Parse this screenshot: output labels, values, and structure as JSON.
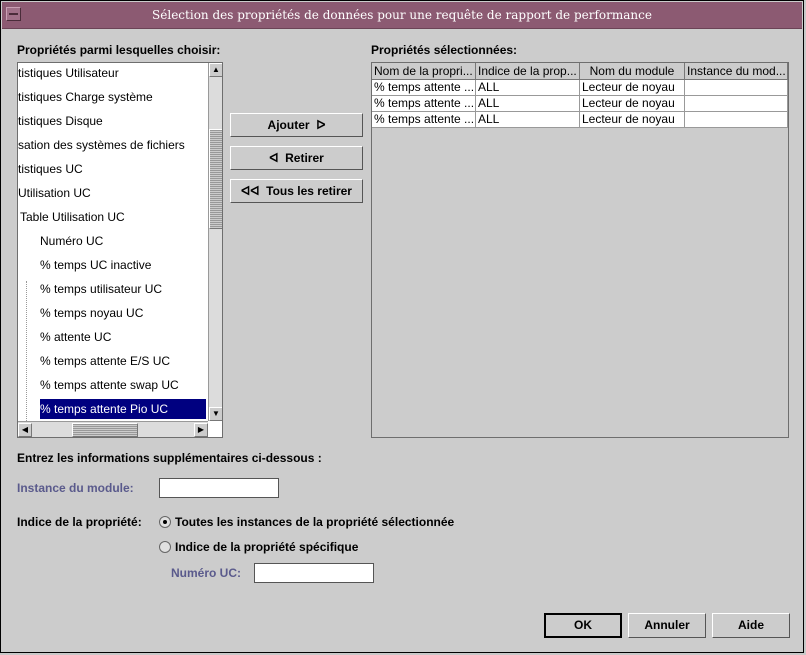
{
  "window": {
    "title": "Sélection des propriétés de données pour une requête de rapport de performance"
  },
  "available": {
    "label": "Propriétés parmi lesquelles choisir:",
    "items": [
      {
        "text": "tistiques Utilisateur",
        "selected": false
      },
      {
        "text": "tistiques Charge système",
        "selected": false
      },
      {
        "text": "tistiques Disque",
        "selected": false
      },
      {
        "text": "sation des systèmes de fichiers",
        "selected": false
      },
      {
        "text": "tistiques UC",
        "selected": false
      },
      {
        "text": "Utilisation UC",
        "selected": false
      },
      {
        "text": "Table Utilisation UC",
        "selected": false
      },
      {
        "text": "Numéro UC",
        "selected": false
      },
      {
        "text": "% temps UC inactive",
        "selected": false
      },
      {
        "text": "% temps utilisateur UC",
        "selected": false
      },
      {
        "text": "% temps noyau UC",
        "selected": false
      },
      {
        "text": "% attente UC",
        "selected": false
      },
      {
        "text": "% temps attente E/S UC",
        "selected": false
      },
      {
        "text": "% temps attente swap UC",
        "selected": false
      },
      {
        "text": "% temps attente Pio UC",
        "selected": true
      }
    ]
  },
  "actions": {
    "add": "Ajouter",
    "remove": "Retirer",
    "remove_all": "Tous les retirer"
  },
  "selected_props": {
    "label": "Propriétés sélectionnées:",
    "columns": [
      "Nom de la propri...",
      "Indice de la prop...",
      "Nom du module",
      "Instance du mod..."
    ],
    "rows": [
      [
        "% temps attente ...",
        "ALL",
        "Lecteur de noyau",
        ""
      ],
      [
        "% temps attente ...",
        "ALL",
        "Lecteur de noyau",
        ""
      ],
      [
        "% temps attente ...",
        "ALL",
        "Lecteur de noyau",
        ""
      ]
    ]
  },
  "extra": {
    "heading": "Entrez les informations supplémentaires ci-dessous :",
    "module_instance_label": "Instance du module:",
    "module_instance_value": "",
    "property_index_label": "Indice de la propriété:",
    "option_all": "Toutes les instances de la propriété sélectionnée",
    "option_specific": "Indice de la propriété spécifique",
    "selected_option": "all",
    "uc_number_label": "Numéro UC:",
    "uc_number_value": ""
  },
  "footer": {
    "ok": "OK",
    "cancel": "Annuler",
    "help": "Aide"
  }
}
